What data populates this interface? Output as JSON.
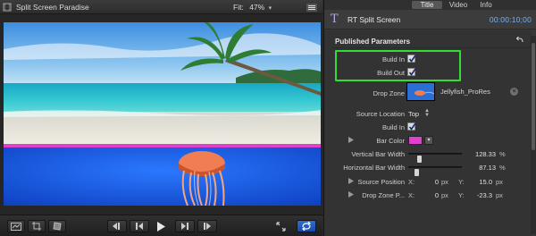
{
  "viewer": {
    "title": "Split Screen Paradise",
    "fit_label": "Fit:",
    "zoom": "47%"
  },
  "inspector": {
    "tabs": [
      "Title",
      "Video",
      "Info"
    ],
    "active_tab": "Title",
    "clip_name": "RT Split Screen",
    "timecode": "00:00:10;00",
    "section_title": "Published Parameters",
    "params": {
      "build_in_label": "Build In",
      "build_in_checked": true,
      "build_out_label": "Build Out",
      "build_out_checked": true,
      "drop_zone_label": "Drop Zone",
      "drop_zone_clip": "Jellyfish_ProRes",
      "source_location_label": "Source Location",
      "source_location_value": "Top",
      "build_in_2_label": "Build In",
      "build_in_2_checked": true,
      "bar_color_label": "Bar Color",
      "bar_color": "#e040d0",
      "vertical_bar_width_label": "Vertical Bar Width",
      "vertical_bar_width_value": "128.33",
      "vertical_bar_width_fraction": 0.18,
      "horizontal_bar_width_label": "Horizontal Bar Width",
      "horizontal_bar_width_value": "87.13",
      "horizontal_bar_width_fraction": 0.12,
      "percent_unit": "%",
      "source_position_label": "Source Position",
      "source_position_x_label": "X:",
      "source_position_x": "0",
      "source_position_y_label": "Y:",
      "source_position_y": "15.0",
      "drop_zone_position_label": "Drop Zone P...",
      "drop_zone_position_x_label": "X:",
      "drop_zone_position_x": "0",
      "drop_zone_position_y_label": "Y:",
      "drop_zone_position_y": "-23.3",
      "px_unit": "px"
    }
  },
  "colors": {
    "highlight": "#33dd33",
    "accent_blue": "#6fb3ff",
    "title_icon": "#b9a7e6",
    "split_bar": "#e040d0"
  },
  "icons": [
    "film-icon",
    "viewer-options-icon",
    "title-t-icon",
    "reset-arrow-icon",
    "disclosure-triangle-icon",
    "clear-x-icon",
    "popup-arrows-icon",
    "play-icon",
    "prev-edit-icon",
    "next-edit-icon",
    "fullscreen-icon",
    "loop-icon"
  ]
}
